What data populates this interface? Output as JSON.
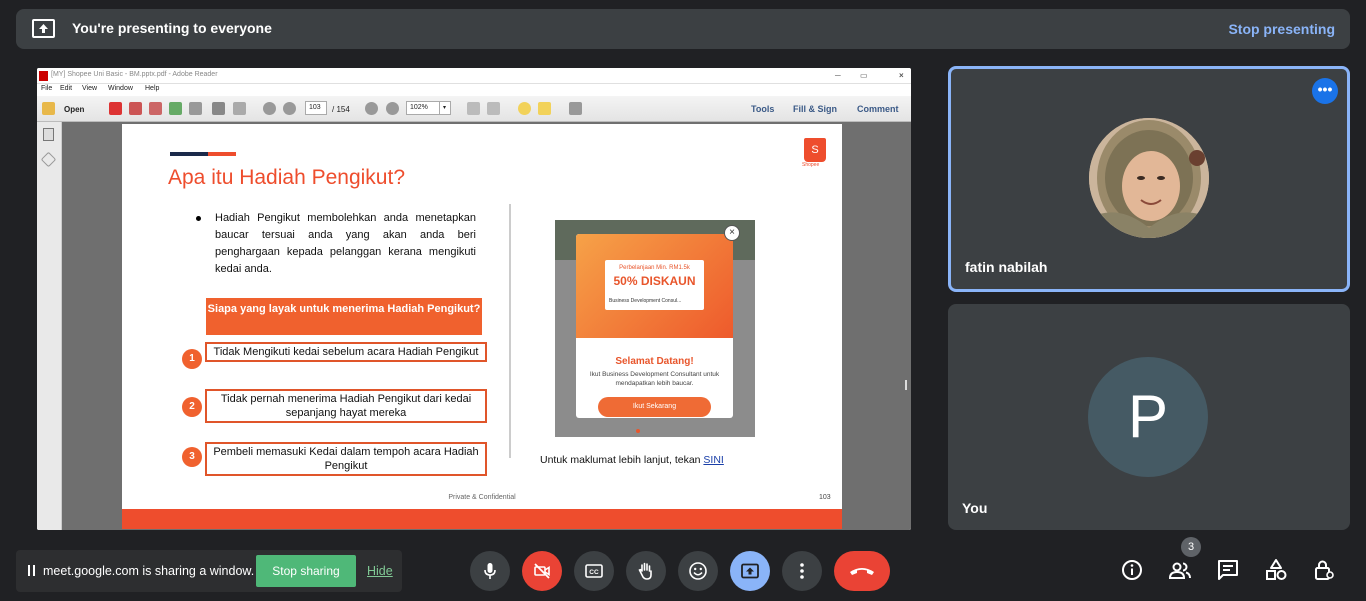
{
  "topbar": {
    "title": "You're presenting to everyone",
    "stop_label": "Stop presenting"
  },
  "presented_window": {
    "title": "[MY] Shopee Uni Basic - BM.pptx.pdf - Adobe Reader",
    "menu": [
      "File",
      "Edit",
      "View",
      "Window",
      "Help"
    ],
    "toolbar": {
      "open_label": "Open",
      "page_current": "103",
      "page_total": "/ 154",
      "zoom": "102%",
      "tools_label": "Tools",
      "fill_sign_label": "Fill & Sign",
      "comment_label": "Comment"
    },
    "slide": {
      "title": "Apa itu Hadiah Pengikut?",
      "logo_label": "Shopee",
      "bullet": "Hadiah Pengikut membolehkan anda menetapkan baucar tersuai anda yang akan anda beri penghargaan kepada pelanggan kerana mengikuti kedai anda.",
      "question": "Siapa yang layak untuk menerima Hadiah Pengikut?",
      "criteria": [
        {
          "num": "1",
          "text": "Tidak Mengikuti kedai sebelum acara Hadiah Pengikut"
        },
        {
          "num": "2",
          "text": "Tidak pernah menerima Hadiah Pengikut dari kedai sepanjang hayat mereka"
        },
        {
          "num": "3",
          "text": "Pembeli memasuki Kedai dalam tempoh acara Hadiah Pengikut"
        }
      ],
      "promo": {
        "coupon_line1": "Perbelanjaan Min. RM1.5k",
        "coupon_line2": "50% DISKAUN",
        "coupon_line3": "Business Development Consul...",
        "welcome": "Selamat Datang!",
        "subtext": "Ikut Business Development Consultant untuk mendapatkan lebih baucar.",
        "button": "Ikut Sekarang"
      },
      "more_info": "Untuk maklumat lebih lanjut, tekan",
      "more_link": "SINI",
      "confidential": "Private & Confidential",
      "page_number": "103"
    }
  },
  "participants": [
    {
      "name": "fatin nabilah"
    },
    {
      "name": "You",
      "initial": "P"
    }
  ],
  "share_notice": {
    "text": "meet.google.com is sharing a window.",
    "stop_label": "Stop sharing",
    "hide_label": "Hide"
  },
  "controls": {
    "people_count": "3"
  },
  "colors": {
    "accent": "#8ab4f8",
    "shopee": "#ee4d2d",
    "end_call": "#ea4335",
    "share_green": "#4fb878"
  }
}
